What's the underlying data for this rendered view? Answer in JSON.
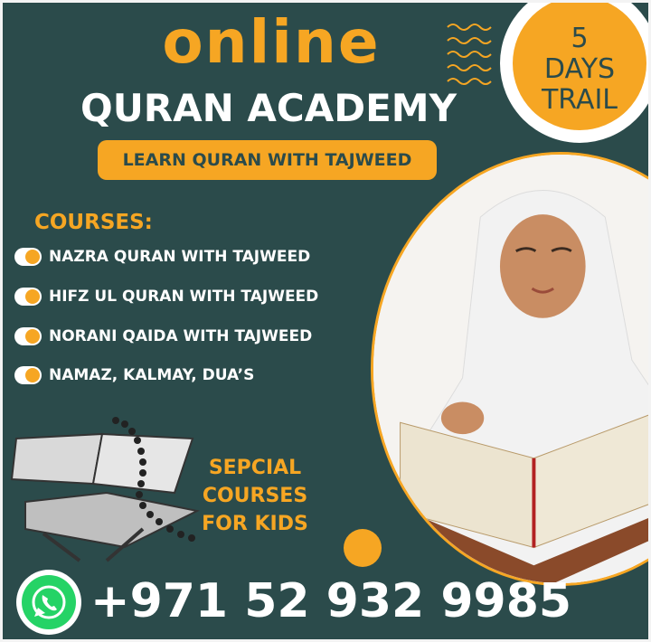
{
  "header": {
    "title_online": "ONLINE",
    "title_academy": "QURAN ACADEMY",
    "tagline": "LEARN QURAN WITH TAJWEED"
  },
  "badge": {
    "line1": "5",
    "line2": "DAYS",
    "line3": "TRAIL"
  },
  "courses": {
    "heading": "COURSES:",
    "items": [
      "NAZRA QURAN WITH TAJWEED",
      "HIFZ UL QURAN WITH TAJWEED",
      "NORANI QAIDA WITH TAJWEED",
      "NAMAZ, KALMAY, DUA’S"
    ]
  },
  "special": {
    "line1": "SEPCIAL",
    "line2": "COURSES",
    "line3": "FOR KIDS"
  },
  "contact": {
    "phone": "+971 52 932 9985",
    "icon": "whatsapp-icon"
  },
  "colors": {
    "background": "#2b4b4b",
    "accent": "#f6a623",
    "text": "#ffffff"
  }
}
